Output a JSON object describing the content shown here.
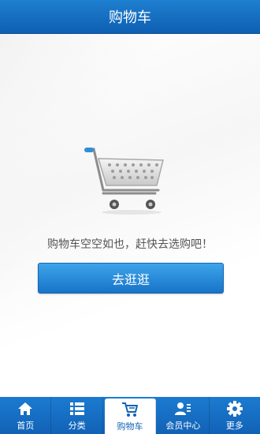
{
  "header": {
    "title": "购物车"
  },
  "main": {
    "empty_message": "购物车空空如也，赶快去选购吧！",
    "go_button_label": "去逛逛"
  },
  "tabbar": {
    "items": [
      {
        "label": "首页",
        "icon": "home-icon"
      },
      {
        "label": "分类",
        "icon": "list-icon"
      },
      {
        "label": "购物车",
        "icon": "cart-icon"
      },
      {
        "label": "会员中心",
        "icon": "member-icon"
      },
      {
        "label": "更多",
        "icon": "gear-icon"
      }
    ],
    "active_index": 2
  },
  "colors": {
    "primary": "#1262b6",
    "button": "#1f86d9"
  }
}
